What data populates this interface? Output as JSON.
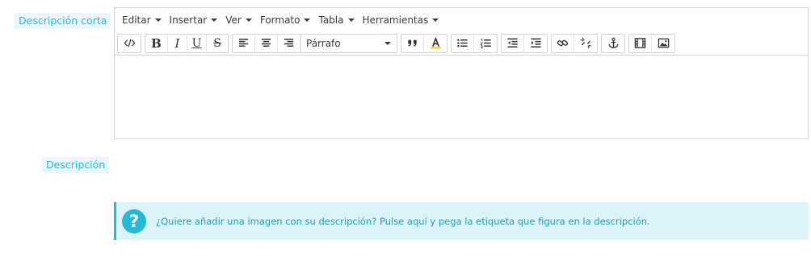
{
  "short_description": {
    "label": "Descripción corta",
    "menus": [
      "Editar",
      "Insertar",
      "Ver",
      "Formato",
      "Tabla",
      "Herramientas"
    ],
    "format_select": "Párrafo"
  },
  "description": {
    "label": "Descripción"
  },
  "alert": {
    "link_text": "¿Quiere añadir una imagen con su descripción? Pulse aquí",
    "rest_text": " y pega la etiqueta que figura en la descripción."
  },
  "colors": {
    "accent": "#25b9d7",
    "alert_bg": "#dcf4f9",
    "label_bg": "#eaf6fb"
  }
}
